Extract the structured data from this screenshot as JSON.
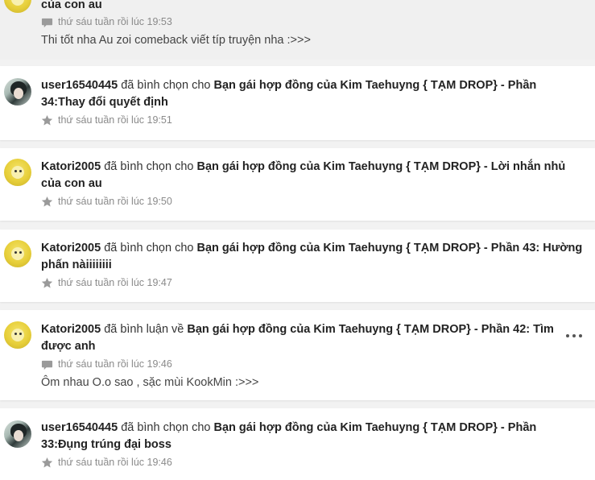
{
  "items": [
    {
      "kind": "comment",
      "title_tail": "của con au",
      "time": "thứ sáu tuần rồi lúc 19:53",
      "comment": "Thi tốt nha Au zoi comeback viết típ truyện nha :>>>"
    },
    {
      "kind": "vote",
      "user": "user16540445",
      "verb": "đã bình chọn cho",
      "title": "Bạn gái hợp đồng của Kim Taehuyng { TẠM DROP} - Phần 34:Thay đổi quyết định",
      "time": "thứ sáu tuần rồi lúc 19:51"
    },
    {
      "kind": "vote",
      "user": "Katori2005",
      "verb": "đã bình chọn cho",
      "title": "Bạn gái hợp đồng của Kim Taehuyng { TẠM DROP} - Lời nhắn nhủ của con au",
      "time": "thứ sáu tuần rồi lúc 19:50"
    },
    {
      "kind": "vote",
      "user": "Katori2005",
      "verb": "đã bình chọn cho",
      "title": "Bạn gái hợp đồng của Kim Taehuyng { TẠM DROP} - Phần 43: Hường phấn nàiiiiiiii",
      "time": "thứ sáu tuần rồi lúc 19:47"
    },
    {
      "kind": "comment",
      "user": "Katori2005",
      "verb": "đã bình luận về",
      "title": "Bạn gái hợp đồng của Kim Taehuyng { TẠM DROP} - Phần 42: Tìm được anh",
      "time": "thứ sáu tuần rồi lúc 19:46",
      "comment": "Ôm nhau O.o sao , sặc mùi KookMin :>>>"
    },
    {
      "kind": "vote",
      "user": "user16540445",
      "verb": "đã bình chọn cho",
      "title": "Bạn gái hợp đồng của Kim Taehuyng { TẠM DROP} - Phần 33:Đụng trúng đại boss",
      "time": "thứ sáu tuần rồi lúc 19:46"
    }
  ],
  "colors": {
    "background": "#f2f2f2",
    "card": "#ffffff",
    "meta": "#8a8a8a"
  }
}
